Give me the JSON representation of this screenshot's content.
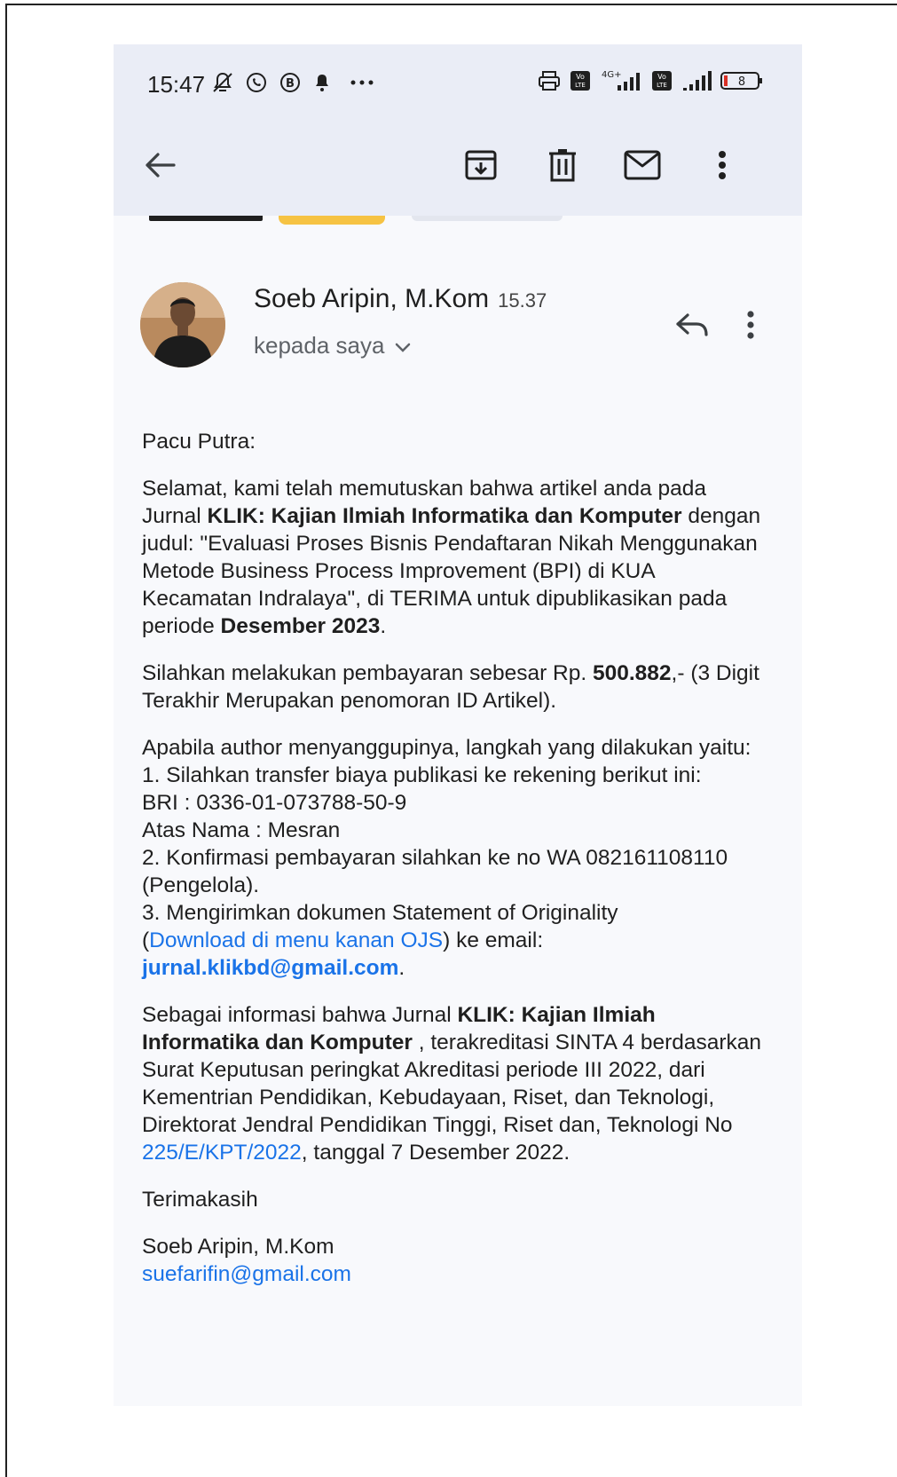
{
  "status_bar": {
    "time": "15:47",
    "icons_left": [
      "mute-icon",
      "whatsapp-icon",
      "b-app-icon",
      "notification-bell-icon",
      "more-dots-icon"
    ],
    "icons_right": [
      "printer-icon",
      "volte-icon",
      "signal-4g-icon",
      "volte-icon",
      "signal-icon",
      "battery-icon"
    ],
    "network": "4G+",
    "lte_label": "Vo LTE",
    "battery": "8"
  },
  "toolbar": {
    "icons": [
      "back-arrow-icon",
      "archive-icon",
      "delete-icon",
      "mail-icon",
      "more-vertical-icon"
    ]
  },
  "email": {
    "sender_name": "Soeb Aripin, M.Kom",
    "time": "15.37",
    "recipient": "kepada saya",
    "greeting": "Pacu Putra:",
    "p1_a": "Selamat, kami telah memutuskan bahwa artikel anda pada Jurnal ",
    "p1_b": "KLIK: Kajian Ilmiah Informatika dan Komputer",
    "p1_c": " dengan judul: \"Evaluasi Proses Bisnis Pendaftaran Nikah Menggunakan Metode Business Process Improvement (BPI) di KUA Kecamatan Indralaya\", di TERIMA untuk dipublikasikan pada periode ",
    "p1_d": "Desember 2023",
    "p1_e": ".",
    "p2_a": "Silahkan melakukan pembayaran sebesar Rp. ",
    "p2_b": "500.882",
    "p2_c": ",- (3 Digit Terakhir Merupakan penomoran ID Artikel).",
    "p3_intro": "Apabila author menyanggupinya, langkah yang dilakukan yaitu:",
    "p3_step1": "1. Silahkan transfer biaya publikasi ke rekening berikut ini:",
    "p3_bank": "BRI : 0336-01-073788-50-9",
    "p3_name": "Atas Nama : Mesran",
    "p3_step2": "2. Konfirmasi pembayaran silahkan ke no WA 082161108110 (Pengelola).",
    "p3_step3": "3. Mengirimkan dokumen Statement of Originality",
    "p3_paren_open": "(",
    "p3_download_link": "Download di menu kanan OJS",
    "p3_after_link": ") ke email:",
    "p3_email": "jurnal.klikbd@gmail.com",
    "p3_period": ".",
    "p4_a": "Sebagai informasi bahwa Jurnal ",
    "p4_b": "KLIK: Kajian Ilmiah Informatika dan Komputer",
    "p4_c": " , terakreditasi SINTA 4 berdasarkan Surat Keputusan peringkat Akreditasi periode III 2022, dari Kementrian Pendidikan, Kebudayaan, Riset, dan Teknologi, Direktorat Jendral Pendidikan Tinggi, Riset dan, Teknologi No ",
    "p4_link": "225/E/KPT/2022",
    "p4_d": ", tanggal 7 Desember 2022.",
    "closing": "Terimakasih",
    "signature_name": "Soeb Aripin, M.Kom",
    "signature_email": "suefarifin@gmail.com"
  }
}
